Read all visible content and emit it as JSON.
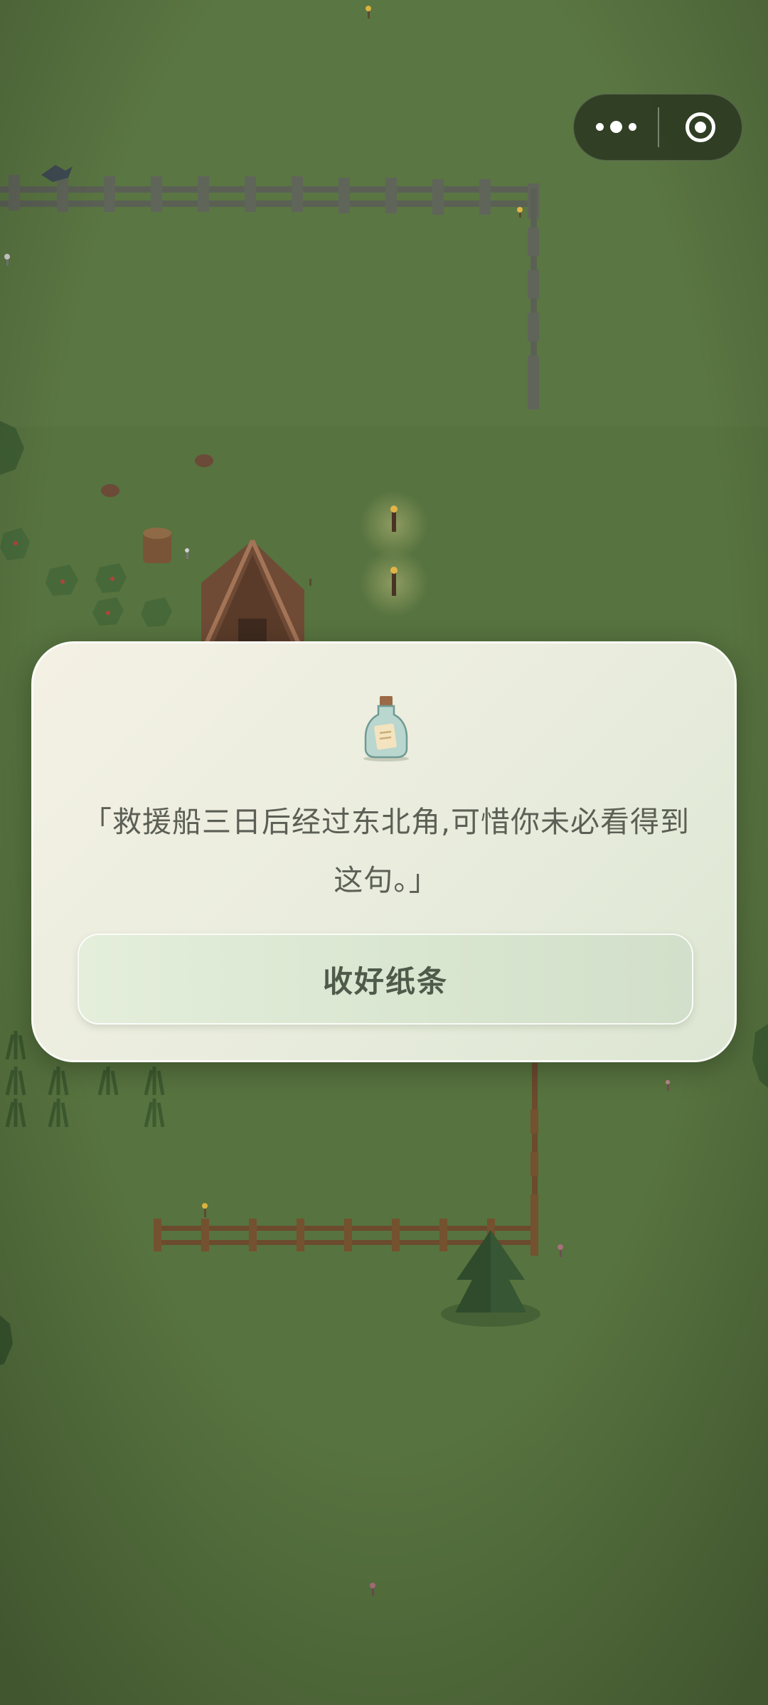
{
  "app": {
    "capsule": {
      "more_icon": "more-dots-icon",
      "close_icon": "target-circle-icon"
    }
  },
  "note_dialog": {
    "icon": "message-bottle-icon",
    "message": "「救援船三日后经过东北角,可惜你未必看得到这句。」",
    "button_label": "收好纸条"
  },
  "colors": {
    "grass": "#57733f",
    "fence_stone": "#5b6055",
    "fence_wood": "#6b4a2e",
    "card_bg": "#eeeee2",
    "button_bg": "#dce8d2",
    "text": "#5b5f55"
  }
}
